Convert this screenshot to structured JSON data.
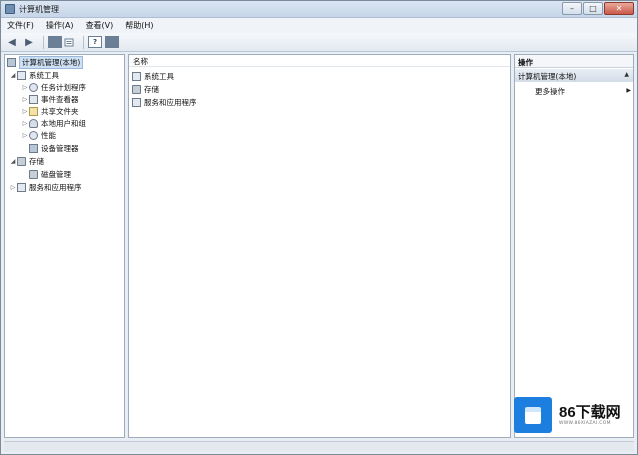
{
  "window": {
    "title": "计算机管理",
    "min_glyph": "–",
    "max_glyph": "□",
    "close_glyph": "✕"
  },
  "menu": [
    "文件(F)",
    "操作(A)",
    "查看(V)",
    "帮助(H)"
  ],
  "toolbar": {
    "back": "◀",
    "forward": "▶",
    "help": "?"
  },
  "tree": {
    "root": "计算机管理(本地)",
    "system_tools": "系统工具",
    "task_scheduler": "任务计划程序",
    "event_viewer": "事件查看器",
    "shared_folders": "共享文件夹",
    "local_users": "本地用户和组",
    "performance": "性能",
    "device_manager": "设备管理器",
    "storage": "存储",
    "disk_management": "磁盘管理",
    "services_apps": "服务和应用程序"
  },
  "list": {
    "column_name": "名称",
    "items": [
      "系统工具",
      "存储",
      "服务和应用程序"
    ]
  },
  "actions": {
    "header": "操作",
    "group": "计算机管理(本地)",
    "more": "更多操作"
  },
  "watermark": {
    "brand": "86下载网",
    "url": "WWW.86XIAZAI.COM"
  }
}
